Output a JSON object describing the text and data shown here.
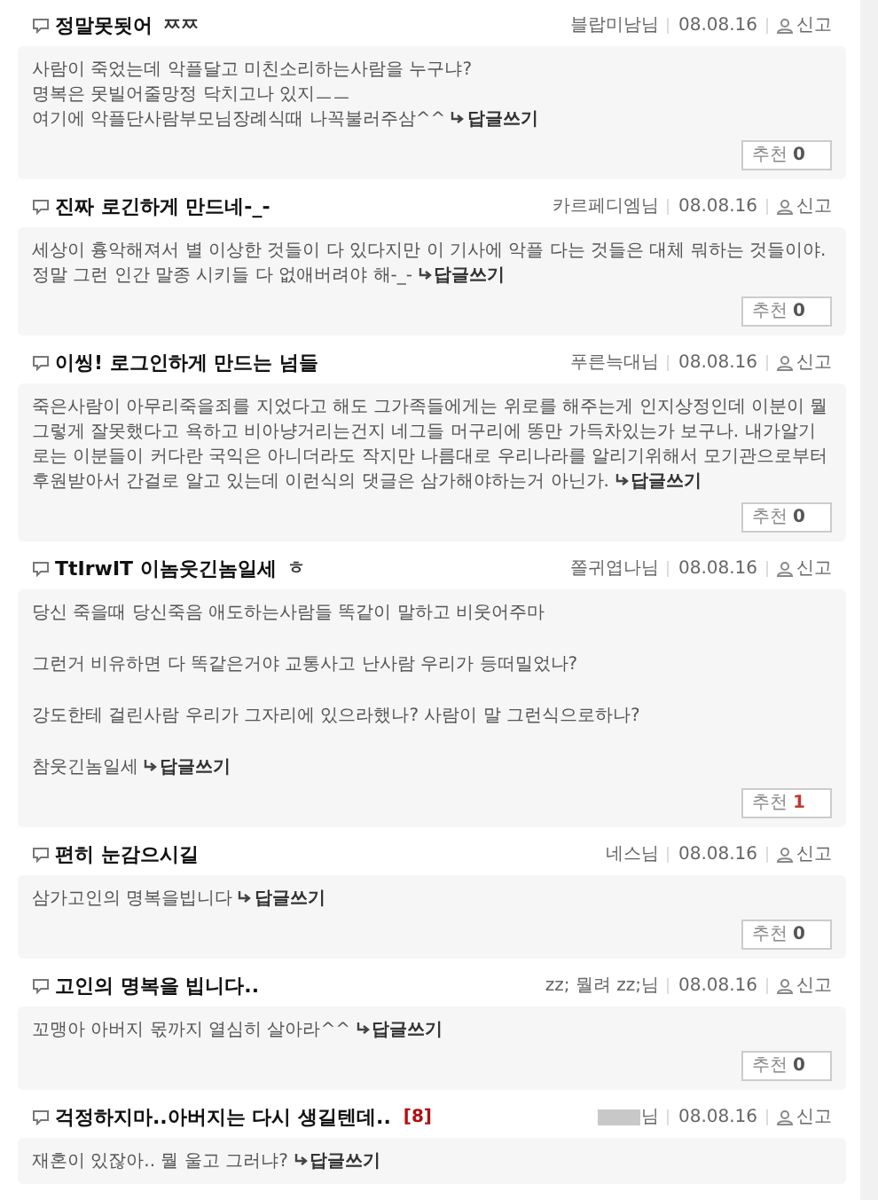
{
  "comments": [
    {
      "title": "정말못됫어",
      "title_suffix": "ㅉㅉ",
      "author": "블랍미남님",
      "date": "08.08.16",
      "report": "신고",
      "lines": [
        "사람이 죽었는데 악플달고 미친소리하는사람을 누구냐?",
        "명복은 못빌어줄망정 닥치고나 있지ㅡㅡ",
        "여기에 악플단사람부모님장례식때 나꼭불러주삼^^"
      ],
      "reply": "답글쓰기",
      "recommend": {
        "label": "추천",
        "count": "0",
        "highlighted": false
      }
    },
    {
      "title": "진짜 로긴하게 만드네-_-",
      "author": "카르페디엠님",
      "date": "08.08.16",
      "report": "신고",
      "lines": [
        "세상이 흉악해져서 별 이상한 것들이 다 있다지만 이 기사에 악플 다는 것들은 대체 뭐하는 것들이야.",
        "정말 그런 인간 말종 시키들 다 없애버려야 해-_-"
      ],
      "reply": "답글쓰기",
      "recommend": {
        "label": "추천",
        "count": "0",
        "highlighted": false
      }
    },
    {
      "title": "이씽! 로그인하게 만드는 넘들",
      "author": "푸른늑대님",
      "date": "08.08.16",
      "report": "신고",
      "lines": [
        "죽은사람이 아무리죽을죄를 지었다고 해도 그가족들에게는 위로를 해주는게 인지상정인데 이분이 뭘그렇게 잘못했다고 욕하고 비아냥거리는건지 네그들 머구리에 똥만 가득차있는가 보구나. 내가알기로는 이분들이 커다란 국익은 아니더라도 작지만 나름대로 우리나라를 알리기위해서 모기관으로부터 후원받아서 간걸로 알고 있는데 이런식의 댓글은 삼가해야하는거 아닌가."
      ],
      "reply": "답글쓰기",
      "recommend": {
        "label": "추천",
        "count": "0",
        "highlighted": false
      }
    },
    {
      "title": "TtIrwIT 이놈웃긴놈일세",
      "title_suffix": "ㅎ",
      "author": "쫄귀엽나님",
      "date": "08.08.16",
      "report": "신고",
      "lines": [
        "당신 죽을때 당신죽음 애도하는사람들 똑같이 말하고 비웃어주마",
        "그런거 비유하면 다 똑같은거야 교통사고 난사람 우리가 등떠밀었나?",
        "강도한테 걸린사람 우리가 그자리에 있으라했나? 사람이 말 그런식으로하나?",
        "참웃긴놈일세"
      ],
      "spaced": true,
      "reply": "답글쓰기",
      "recommend": {
        "label": "추천",
        "count": "1",
        "highlighted": true
      }
    },
    {
      "title": "편히 눈감으시길",
      "author": "네스님",
      "date": "08.08.16",
      "report": "신고",
      "lines": [
        "삼가고인의 명복을빕니다"
      ],
      "reply": "답글쓰기",
      "recommend": {
        "label": "추천",
        "count": "0",
        "highlighted": false
      }
    },
    {
      "title": "고인의 명복을 빕니다..",
      "author": "zz; 뭘려 zz;님",
      "date": "08.08.16",
      "report": "신고",
      "lines": [
        "꼬맹아 아버지 몫까지 열심히 살아라^^"
      ],
      "reply": "답글쓰기",
      "recommend": {
        "label": "추천",
        "count": "0",
        "highlighted": false
      }
    },
    {
      "title": "걱정하지마..아버지는 다시 생길텐데..",
      "count": "[8]",
      "author": "님",
      "author_redacted": true,
      "date": "08.08.16",
      "report": "신고",
      "lines": [
        "재혼이 있잖아.. 뭘 울고 그러냐?"
      ],
      "reply": "답글쓰기"
    }
  ]
}
